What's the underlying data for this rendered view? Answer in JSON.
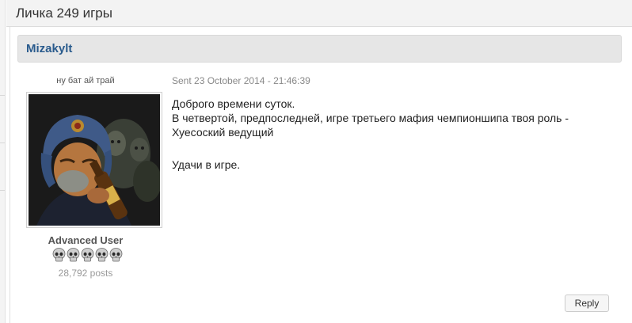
{
  "page": {
    "title": "Личка 249 игры"
  },
  "post": {
    "author": "Mizakylt",
    "user_title": "ну бат ай трай",
    "sent": "Sent 23 October 2014 - 21:46:39",
    "message_lines": [
      "Доброго времени суток.",
      "В четвертой, предпоследней, игре третьего мафия чемпионшипа твоя роль -",
      "Хуесоский ведущий",
      "Удачи в игре."
    ],
    "rank": "Advanced User",
    "rank_icons": [
      "skull-icon",
      "skull-icon",
      "skull-icon",
      "skull-icon",
      "skull-icon"
    ],
    "posts": "28,792 posts",
    "reply_label": "Reply"
  },
  "colors": {
    "author_link": "#2a5b8d",
    "author_bar": "#e6e6e6",
    "title_bar": "#f3f3f3"
  }
}
